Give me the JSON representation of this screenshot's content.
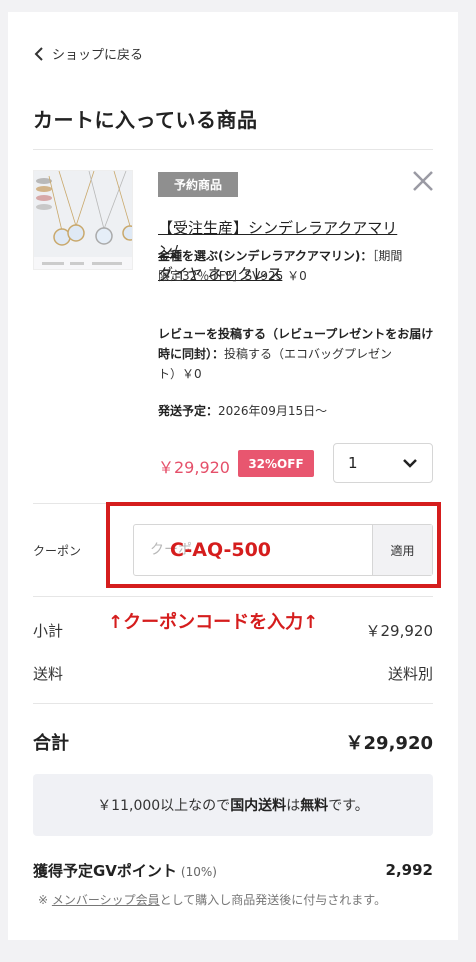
{
  "nav": {
    "back_label": "ショップに戻る"
  },
  "page": {
    "title": "カートに入っている商品"
  },
  "item": {
    "badge": "予約商品",
    "name_line1": "【受注生産】シンデレラアクアマリン/",
    "name_line2": "ダイヤ ネックレス",
    "option1_label": "金種を選ぶ(シンデレラアクアマリン)：",
    "option1_value_a": "［期間",
    "option1_value_b": "限定32％OFF］SV925 ￥0",
    "option2_label_a": "レビューを投稿する（レビュープレゼントをお届け",
    "option2_label_b": "時に同封）：",
    "option2_value_a": "投稿する（エコバッグプレゼン",
    "option2_value_b": "ト）￥0",
    "ship_label": "発送予定：",
    "ship_value": "2026年09月15日〜",
    "price": "￥29,920",
    "discount_badge": "32%OFF",
    "quantity": "1"
  },
  "coupon": {
    "label": "クーポン",
    "placeholder": "クーポ",
    "apply_label": "適用",
    "annotation_code": "C-AQ-500",
    "annotation_hint": "↑クーポンコードを入力↑"
  },
  "summary": {
    "subtotal_label": "小計",
    "subtotal_value": "￥29,920",
    "shipping_label": "送料",
    "shipping_value": "送料別",
    "total_label": "合計",
    "total_value": "￥29,920"
  },
  "notice": {
    "text_a": "￥11,000以上なので",
    "text_b": "国内送料",
    "text_c": "は",
    "text_d": "無料",
    "text_e": "です。"
  },
  "points": {
    "label": "獲得予定GVポイント",
    "rate": "(10%)",
    "value": "2,992",
    "note_prefix": "※",
    "note_link": "メンバーシップ会員",
    "note_suffix": "として購入し商品発送後に付与されます。"
  },
  "colors": {
    "accent": "#e5506a",
    "annotation": "#d51d1d",
    "badge_gray": "#8f8f8f"
  },
  "icons": {
    "back": "chevron-left-icon",
    "remove": "close-icon",
    "qty": "chevron-down-icon"
  }
}
